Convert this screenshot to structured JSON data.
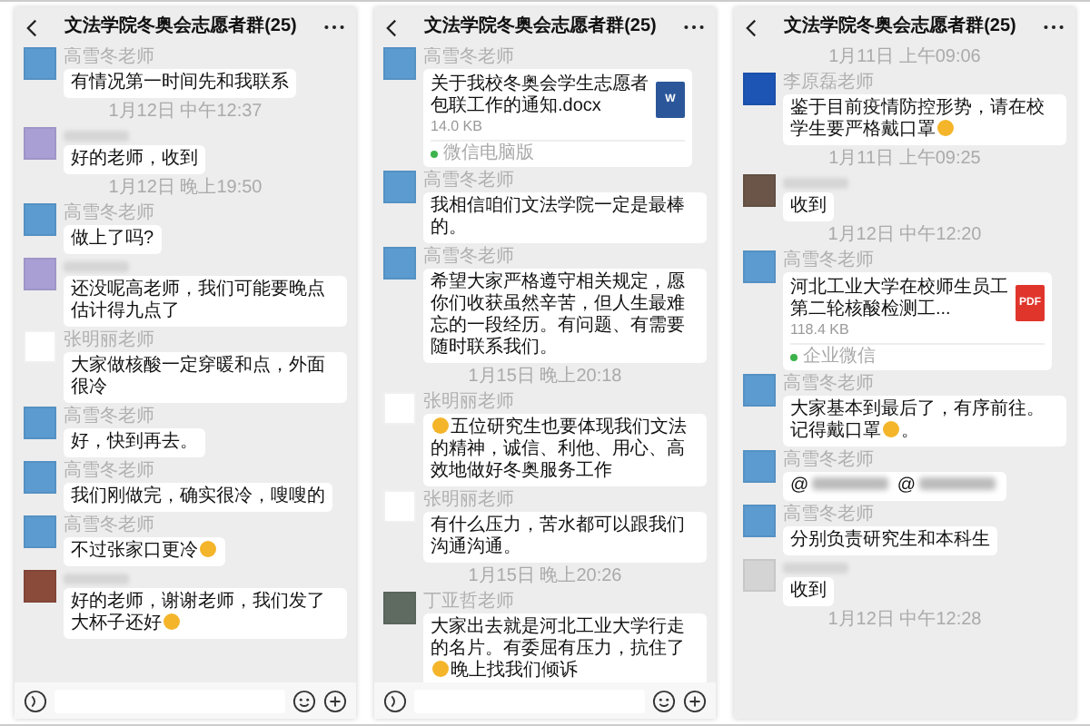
{
  "phones": [
    {
      "title": "文法学院冬奥会志愿者群(25)",
      "input_bar": true,
      "items": [
        {
          "kind": "text",
          "sender": "高雪冬老师",
          "avatar": {
            "color": "#5b9bd0"
          },
          "segments": [
            {
              "kind": "text",
              "text": "有情况第一时间先和我联系"
            }
          ]
        },
        {
          "kind": "time",
          "text": "1月12日 中午12:37"
        },
        {
          "kind": "text",
          "sender_blurred": true,
          "avatar": {
            "color": "#a99fd4"
          },
          "segments": [
            {
              "kind": "text",
              "text": "好的老师，收到"
            }
          ]
        },
        {
          "kind": "time",
          "text": "1月12日 晚上19:50"
        },
        {
          "kind": "text",
          "sender": "高雪冬老师",
          "avatar": {
            "color": "#5b9bd0"
          },
          "segments": [
            {
              "kind": "text",
              "text": "做上了吗?"
            }
          ]
        },
        {
          "kind": "text",
          "sender_blurred": true,
          "avatar": {
            "color": "#a99fd4"
          },
          "segments": [
            {
              "kind": "text",
              "text": "还没呢高老师，我们可能要晚点估计得九点了"
            }
          ]
        },
        {
          "kind": "text",
          "sender": "张明丽老师",
          "avatar": {
            "color": "#ffffff"
          },
          "segments": [
            {
              "kind": "text",
              "text": "大家做核酸一定穿暖和点，外面很冷"
            }
          ]
        },
        {
          "kind": "text",
          "sender": "高雪冬老师",
          "avatar": {
            "color": "#5b9bd0"
          },
          "segments": [
            {
              "kind": "text",
              "text": "好，快到再去。"
            }
          ]
        },
        {
          "kind": "text",
          "sender": "高雪冬老师",
          "avatar": {
            "color": "#5b9bd0"
          },
          "segments": [
            {
              "kind": "text",
              "text": "我们刚做完，确实很冷，嗖嗖的"
            }
          ]
        },
        {
          "kind": "text",
          "sender": "高雪冬老师",
          "avatar": {
            "color": "#5b9bd0"
          },
          "segments": [
            {
              "kind": "text",
              "text": "不过张家口更冷"
            },
            {
              "kind": "emoji"
            }
          ]
        },
        {
          "kind": "text",
          "sender_blurred": true,
          "avatar": {
            "color": "#8b4b3b"
          },
          "segments": [
            {
              "kind": "text",
              "text": "好的老师，谢谢老师，我们发了大杯子还好"
            },
            {
              "kind": "emoji"
            }
          ]
        }
      ]
    },
    {
      "title": "文法学院冬奥会志愿者群(25)",
      "input_bar": true,
      "items": [
        {
          "kind": "file",
          "sender": "高雪冬老师",
          "avatar": {
            "color": "#5b9bd0"
          },
          "name": "关于我校冬奥会学生志愿者包联工作的通知.docx",
          "size": "14.0 KB",
          "source": "微信电脑版",
          "file_icon": {
            "color": "#2b579a",
            "label": "W"
          }
        },
        {
          "kind": "text",
          "sender": "高雪冬老师",
          "avatar": {
            "color": "#5b9bd0"
          },
          "segments": [
            {
              "kind": "text",
              "text": "我相信咱们文法学院一定是最棒的。"
            }
          ]
        },
        {
          "kind": "text",
          "sender": "高雪冬老师",
          "avatar": {
            "color": "#5b9bd0"
          },
          "segments": [
            {
              "kind": "text",
              "text": "希望大家严格遵守相关规定，愿你们收获虽然辛苦，但人生最难忘的一段经历。有问题、有需要随时联系我们。"
            }
          ]
        },
        {
          "kind": "time",
          "text": "1月15日 晚上20:18"
        },
        {
          "kind": "text",
          "sender": "张明丽老师",
          "avatar": {
            "color": "#ffffff"
          },
          "segments": [
            {
              "kind": "emoji"
            },
            {
              "kind": "text",
              "text": "五位研究生也要体现我们文法的精神，诚信、利他、用心、高效地做好冬奥服务工作"
            }
          ]
        },
        {
          "kind": "text",
          "sender": "张明丽老师",
          "avatar": {
            "color": "#ffffff"
          },
          "segments": [
            {
              "kind": "text",
              "text": "有什么压力，苦水都可以跟我们沟通沟通。"
            }
          ]
        },
        {
          "kind": "time",
          "text": "1月15日 晚上20:26"
        },
        {
          "kind": "text",
          "sender": "丁亚哲老师",
          "avatar": {
            "color": "#5f6b60"
          },
          "segments": [
            {
              "kind": "text",
              "text": "大家出去就是河北工业大学行走的名片。有委屈有压力，抗住了"
            },
            {
              "kind": "emoji"
            },
            {
              "kind": "text",
              "text": "晚上找我们倾诉"
            }
          ]
        }
      ]
    },
    {
      "title": "文法学院冬奥会志愿者群(25)",
      "input_bar": false,
      "items": [
        {
          "kind": "time",
          "text": "1月11日 上午09:06"
        },
        {
          "kind": "text",
          "sender": "李原磊老师",
          "avatar": {
            "color": "#1d55b5"
          },
          "segments": [
            {
              "kind": "text",
              "text": "鉴于目前疫情防控形势，请在校学生要严格戴口罩"
            },
            {
              "kind": "emoji"
            }
          ]
        },
        {
          "kind": "time",
          "text": "1月11日 上午09:25"
        },
        {
          "kind": "text",
          "sender_blurred": true,
          "avatar": {
            "color": "#6a5548"
          },
          "segments": [
            {
              "kind": "text",
              "text": "收到"
            }
          ]
        },
        {
          "kind": "time",
          "text": "1月12日 中午12:20"
        },
        {
          "kind": "file",
          "sender": "高雪冬老师",
          "avatar": {
            "color": "#5b9bd0"
          },
          "name": "河北工业大学在校师生员工第二轮核酸检测工...",
          "size": "118.4 KB",
          "source": "企业微信",
          "file_icon": {
            "color": "#e0352b",
            "label": "PDF"
          }
        },
        {
          "kind": "text",
          "sender": "高雪冬老师",
          "avatar": {
            "color": "#5b9bd0"
          },
          "segments": [
            {
              "kind": "text",
              "text": "大家基本到最后了，有序前往。记得戴口罩"
            },
            {
              "kind": "emoji"
            },
            {
              "kind": "text",
              "text": "。"
            }
          ]
        },
        {
          "kind": "text",
          "sender": "高雪冬老师",
          "avatar": {
            "color": "#5b9bd0"
          },
          "segments": [
            {
              "kind": "text",
              "text": "@"
            },
            {
              "kind": "blur"
            },
            {
              "kind": "text",
              "text": " @"
            },
            {
              "kind": "blur"
            }
          ]
        },
        {
          "kind": "text",
          "sender": "高雪冬老师",
          "avatar": {
            "color": "#5b9bd0"
          },
          "segments": [
            {
              "kind": "text",
              "text": "分别负责研究生和本科生"
            }
          ]
        },
        {
          "kind": "text",
          "sender_blurred": true,
          "avatar": {
            "color": "#d4d4d4"
          },
          "segments": [
            {
              "kind": "text",
              "text": "收到"
            }
          ]
        },
        {
          "kind": "time",
          "text": "1月12日 中午12:28"
        }
      ]
    }
  ]
}
